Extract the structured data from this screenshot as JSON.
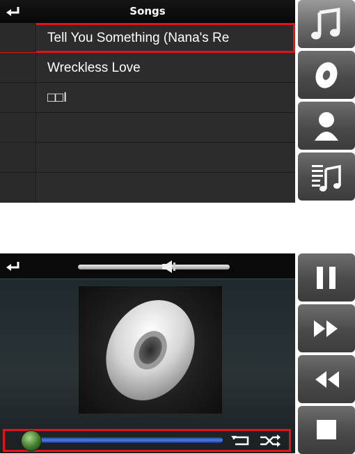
{
  "songs_panel": {
    "title": "Songs",
    "back_icon": "back-arrow-icon",
    "rows": [
      {
        "name": "Tell You Something (Nana's Re",
        "selected": true
      },
      {
        "name": "Wreckless Love",
        "selected": false
      },
      {
        "name": "□□I",
        "selected": false
      },
      {
        "name": "",
        "selected": false
      },
      {
        "name": "",
        "selected": false
      },
      {
        "name": "",
        "selected": false
      }
    ],
    "side_nav": [
      {
        "icon": "music-note-icon",
        "active": true
      },
      {
        "icon": "disc-icon",
        "active": false
      },
      {
        "icon": "artist-icon",
        "active": false
      },
      {
        "icon": "playlist-icon",
        "active": false
      }
    ]
  },
  "player": {
    "back_icon": "back-arrow-icon",
    "volume_icon": "speaker-icon",
    "cover_icon": "disc-icon",
    "seek_icon": "seek-knob",
    "repeat_icon": "repeat-icon",
    "shuffle_icon": "shuffle-icon",
    "controls": [
      "pause-icon",
      "fast-forward-icon",
      "rewind-icon",
      "stop-icon"
    ]
  },
  "colors": {
    "highlight": "#e0141b",
    "progress": "#3b6ed0",
    "knob": "#4f8a34"
  }
}
